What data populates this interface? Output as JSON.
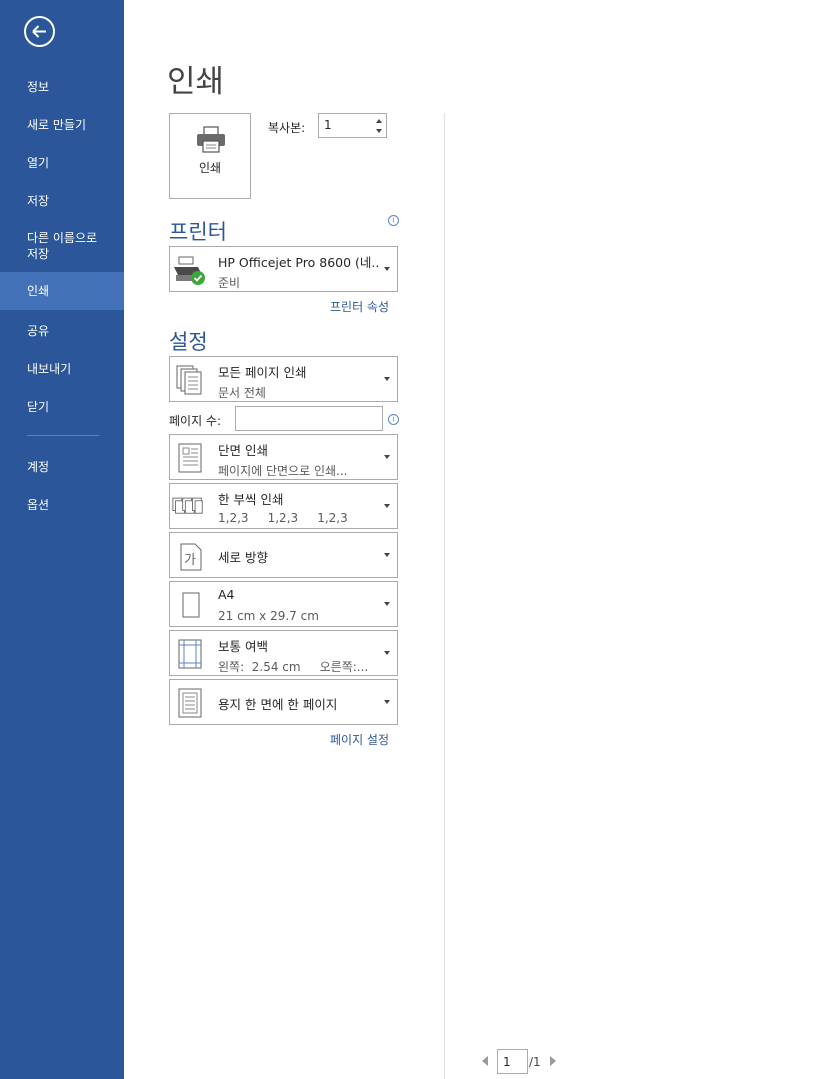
{
  "sidebar": {
    "items": [
      {
        "label": "정보"
      },
      {
        "label": "새로 만들기"
      },
      {
        "label": "열기"
      },
      {
        "label": "저장"
      },
      {
        "label": "다른 이름으로\n저장"
      },
      {
        "label": "인쇄",
        "active": true
      },
      {
        "label": "공유"
      },
      {
        "label": "내보내기"
      },
      {
        "label": "닫기"
      },
      {
        "label": "계정"
      },
      {
        "label": "옵션"
      }
    ]
  },
  "page_title": "인쇄",
  "print_button_label": "인쇄",
  "copies": {
    "label": "복사본:",
    "value": "1"
  },
  "printer_section": {
    "title": "프린터",
    "printer_name": "HP Officejet Pro 8600 (네...",
    "status": "준비",
    "properties_link": "프린터 속성"
  },
  "settings_section": {
    "title": "설정",
    "pages_label": "페이지 수:",
    "pages_value": "",
    "options": [
      {
        "main": "모든 페이지 인쇄",
        "sub": "문서 전체"
      },
      {
        "main": "단면 인쇄",
        "sub": "페이지에 단면으로 인쇄..."
      },
      {
        "main": "한 부씩 인쇄",
        "sub": "1,2,3     1,2,3     1,2,3"
      },
      {
        "main": "세로 방향",
        "sub": ""
      },
      {
        "main": "A4",
        "sub": "21 cm x 29.7 cm"
      },
      {
        "main": "보통 여백",
        "sub": "왼쪽:  2.54 cm     오른쪽:..."
      },
      {
        "main": "용지 한 면에 한 페이지",
        "sub": ""
      }
    ],
    "page_setup_link": "페이지 설정"
  },
  "pager": {
    "current": "1",
    "total": "/1"
  },
  "colors": {
    "sidebar": "#2b579a",
    "sidebar_active": "#4472b8",
    "accent": "#2b579a"
  }
}
